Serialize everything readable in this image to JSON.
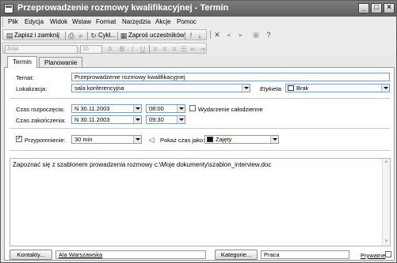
{
  "window": {
    "title": "Przeprowadzenie rozmowy kwalifikacyjnej - Termin",
    "icons": [
      "appointment-icon",
      "minimize-icon",
      "maximize-icon",
      "close-icon"
    ]
  },
  "menubar": {
    "items": [
      "Plik",
      "Edycja",
      "Widok",
      "Wstaw",
      "Format",
      "Narzędzia",
      "Akcje",
      "Pomoc"
    ]
  },
  "toolbar": {
    "save_close": "Zapisz i zamknij",
    "recurrence": "Cykl...",
    "invite": "Zaproś uczestników",
    "font_name": "Arial",
    "font_size": "10"
  },
  "tabs": [
    "Termin",
    "Planowanie"
  ],
  "form": {
    "subject_label": "Temat:",
    "subject_value": "Przeprowadzenie rozmowy kwalifikacyjnej",
    "location_label": "Lokalizacja:",
    "location_value": "sala konferencyjna",
    "label_label": "Etykieta:",
    "label_value": "Brak",
    "start_label": "Czas rozpoczęcia:",
    "start_date": "N 30.11.2003",
    "start_time": "08:00",
    "end_label": "Czas zakończenia:",
    "end_date": "N 30.11.2003",
    "end_time": "09:30",
    "allday_label": "Wydarzenie całodzienne",
    "reminder_label": "Przypomnienie:",
    "reminder_value": "30 min",
    "showas_label": "Pokaż czas jako:",
    "showas_value": "Zajęty",
    "notes": "Zapoznać się z szablonem prowadzenia rozmowy c:\\Moje dokumenty\\szablon_interview.doc"
  },
  "footer": {
    "contacts_button": "Kontakty...",
    "contacts_value": "Ala Warszawska",
    "categories_button": "Kategorie...",
    "categories_value": "Praca",
    "private_label": "Prywatne"
  },
  "colors": {
    "titlebar": "#6b6b6b",
    "showas_swatch": "#111111",
    "label_swatch": "#ffffff"
  }
}
